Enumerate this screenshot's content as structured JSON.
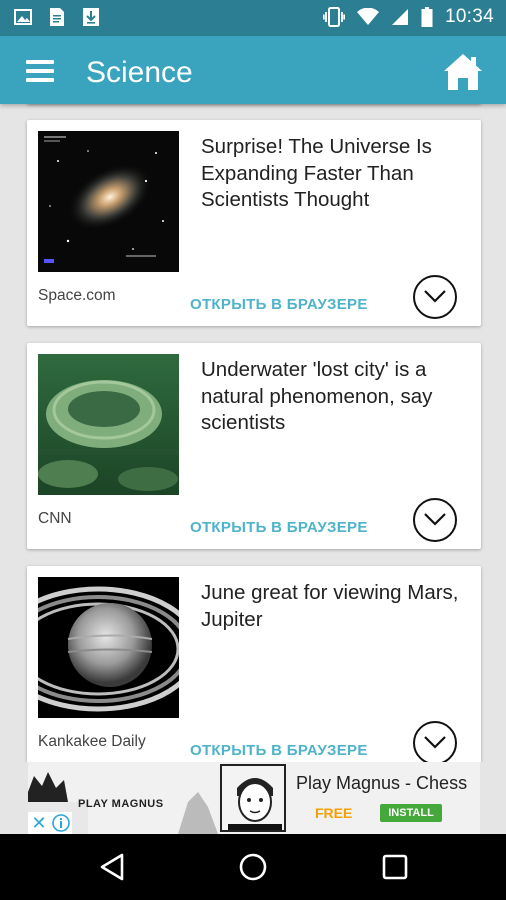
{
  "status_bar": {
    "time": "10:34",
    "left_icons": [
      "image-icon",
      "document-icon",
      "download-icon"
    ],
    "right_icons": [
      "vibrate-icon",
      "wifi-icon",
      "signal-icon",
      "battery-icon"
    ]
  },
  "app_bar": {
    "title": "Science",
    "menu_icon": "hamburger-menu-icon",
    "home_icon": "home-icon",
    "color": "#3aa3bd"
  },
  "articles": [
    {
      "title": "Surprise! The Universe Is Expanding Faster Than Scientists Thought",
      "source": "Space.com",
      "open_label": "ОТКРЫТЬ В БРАУЗЕРЕ",
      "thumb_icon": "galaxy-image"
    },
    {
      "title": "Underwater 'lost city' is a natural phenomenon, say scientists",
      "source": "CNN",
      "open_label": "ОТКРЫТЬ В БРАУЗЕРЕ",
      "thumb_icon": "underwater-formation-image"
    },
    {
      "title": "June great for viewing Mars, Jupiter",
      "source": "Kankakee Daily",
      "open_label": "ОТКРЫТЬ В БРАУЗЕРЕ",
      "thumb_icon": "saturn-image"
    }
  ],
  "ad": {
    "logo_text": "PLAY MAGNUS",
    "title": "Play Magnus - Chess",
    "price": "FREE",
    "install_label": "INSTALL",
    "close_icon": "close-icon",
    "info_icon": "info-icon"
  },
  "nav_bar": {
    "icons": [
      "back-icon",
      "home-circle-icon",
      "recents-icon"
    ]
  },
  "colors": {
    "status_bar": "#2c7f93",
    "accent": "#4fb3c9",
    "background": "#e5e5e5"
  }
}
